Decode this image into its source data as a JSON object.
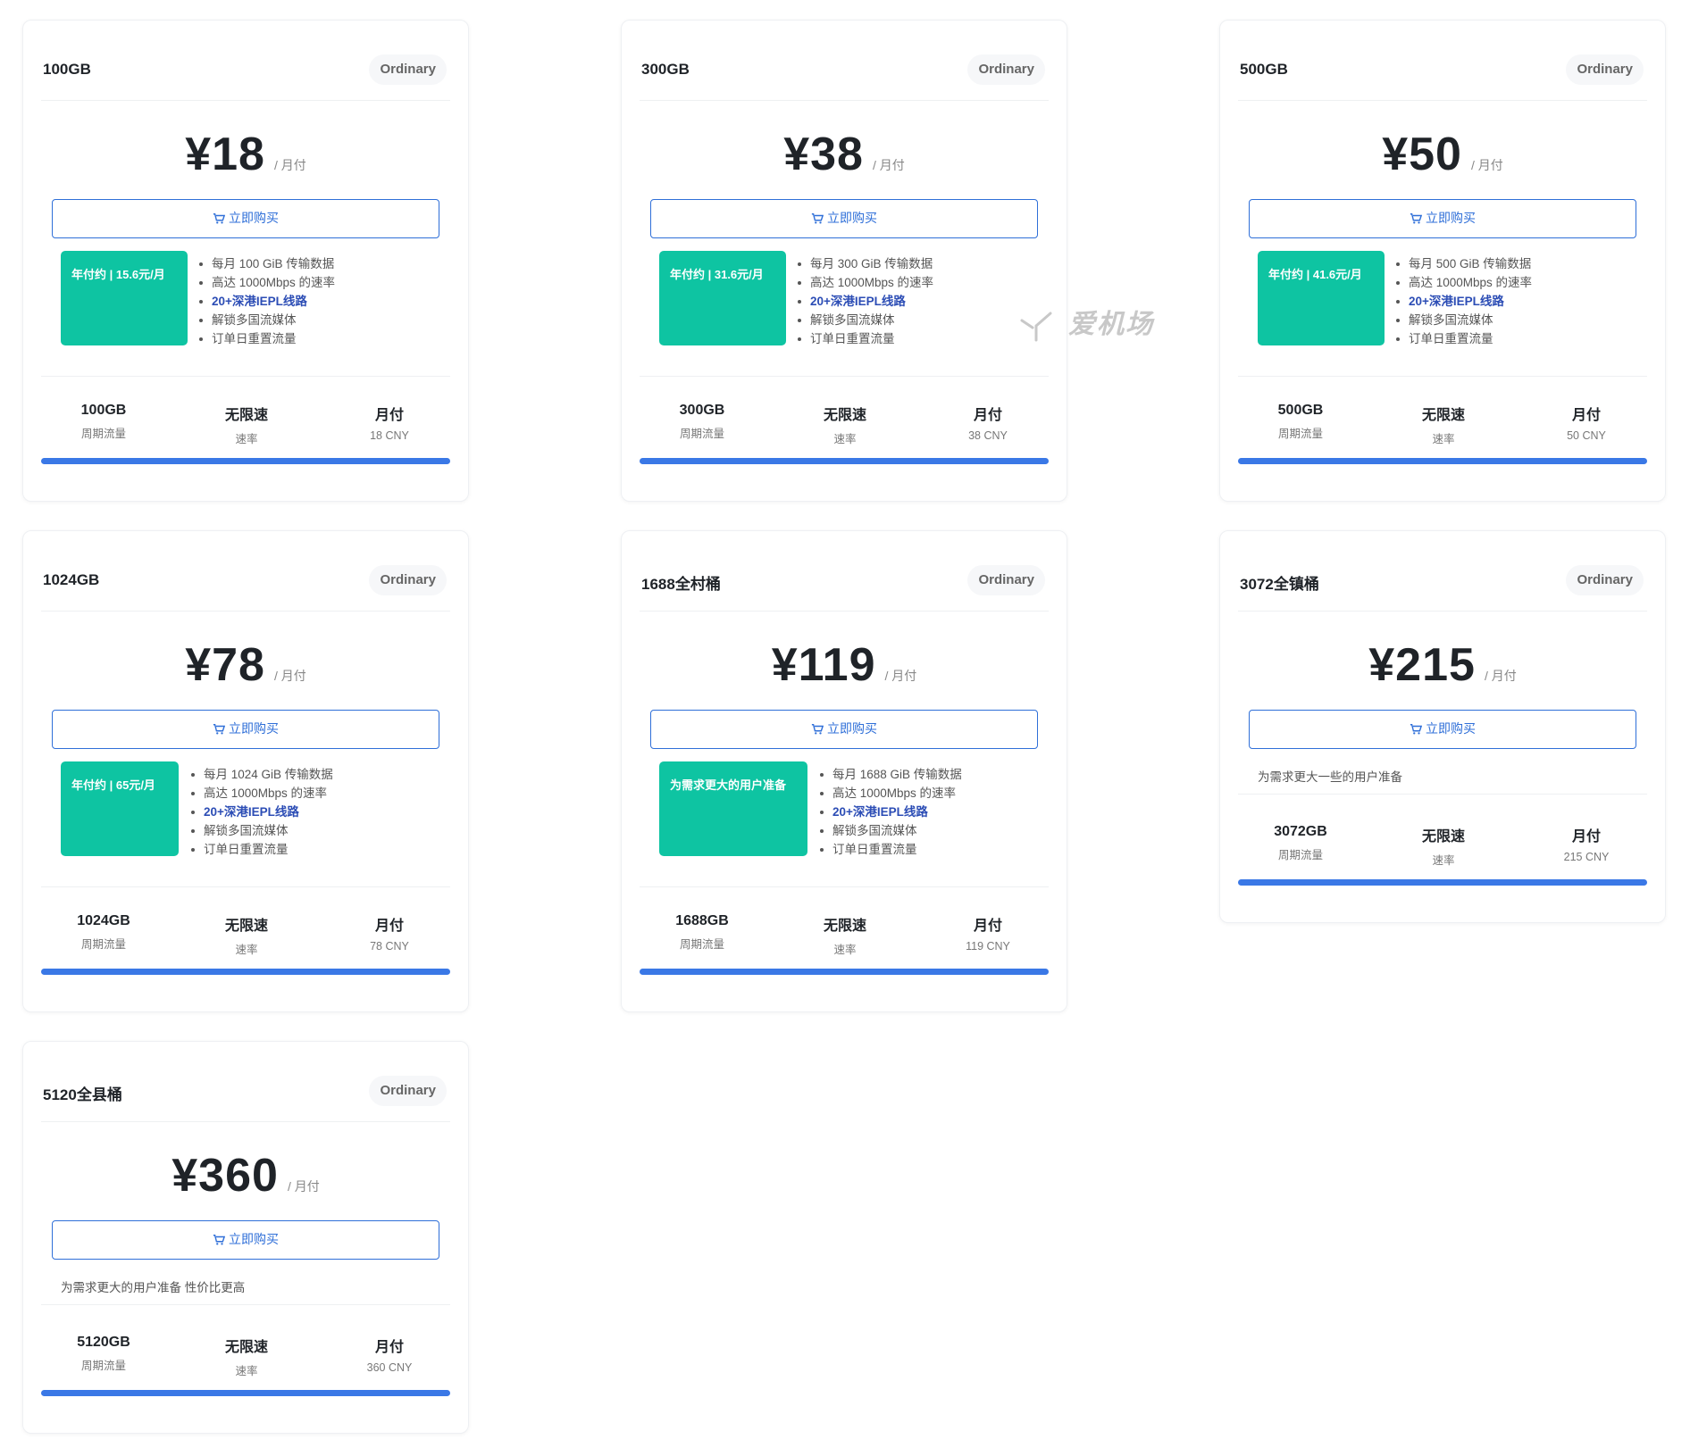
{
  "watermark": "爱机场",
  "cards": [
    {
      "title": "100GB",
      "badge": "Ordinary",
      "price": "¥18",
      "period": "/ 月付",
      "buy_label": "立即购买",
      "promo": "年付约 | 15.6元/月",
      "features": [
        "每月 100 GiB 传输数据",
        "高达 1000Mbps 的速率",
        "20+深港IEPL线路",
        "解锁多国流媒体",
        "订单日重置流量"
      ],
      "stats": [
        {
          "value": "100GB",
          "label": "周期流量"
        },
        {
          "value": "无限速",
          "label": "速率"
        },
        {
          "value": "月付",
          "label": "18 CNY"
        }
      ]
    },
    {
      "title": "300GB",
      "badge": "Ordinary",
      "price": "¥38",
      "period": "/ 月付",
      "buy_label": "立即购买",
      "promo": "年付约 | 31.6元/月",
      "features": [
        "每月 300 GiB 传输数据",
        "高达 1000Mbps 的速率",
        "20+深港IEPL线路",
        "解锁多国流媒体",
        "订单日重置流量"
      ],
      "stats": [
        {
          "value": "300GB",
          "label": "周期流量"
        },
        {
          "value": "无限速",
          "label": "速率"
        },
        {
          "value": "月付",
          "label": "38 CNY"
        }
      ]
    },
    {
      "title": "500GB",
      "badge": "Ordinary",
      "price": "¥50",
      "period": "/ 月付",
      "buy_label": "立即购买",
      "promo": "年付约 | 41.6元/月",
      "features": [
        "每月 500 GiB 传输数据",
        "高达 1000Mbps 的速率",
        "20+深港IEPL线路",
        "解锁多国流媒体",
        "订单日重置流量"
      ],
      "stats": [
        {
          "value": "500GB",
          "label": "周期流量"
        },
        {
          "value": "无限速",
          "label": "速率"
        },
        {
          "value": "月付",
          "label": "50 CNY"
        }
      ]
    },
    {
      "title": "1024GB",
      "badge": "Ordinary",
      "price": "¥78",
      "period": "/ 月付",
      "buy_label": "立即购买",
      "promo": "年付约 | 65元/月",
      "features": [
        "每月 1024 GiB 传输数据",
        "高达 1000Mbps 的速率",
        "20+深港IEPL线路",
        "解锁多国流媒体",
        "订单日重置流量"
      ],
      "stats": [
        {
          "value": "1024GB",
          "label": "周期流量"
        },
        {
          "value": "无限速",
          "label": "速率"
        },
        {
          "value": "月付",
          "label": "78 CNY"
        }
      ]
    },
    {
      "title": "1688全村桶",
      "badge": "Ordinary",
      "price": "¥119",
      "period": "/ 月付",
      "buy_label": "立即购买",
      "promo": "为需求更大的用户准备",
      "features": [
        "每月 1688 GiB 传输数据",
        "高达 1000Mbps 的速率",
        "20+深港IEPL线路",
        "解锁多国流媒体",
        "订单日重置流量"
      ],
      "stats": [
        {
          "value": "1688GB",
          "label": "周期流量"
        },
        {
          "value": "无限速",
          "label": "速率"
        },
        {
          "value": "月付",
          "label": "119 CNY"
        }
      ]
    },
    {
      "title": "3072全镇桶",
      "badge": "Ordinary",
      "price": "¥215",
      "period": "/ 月付",
      "buy_label": "立即购买",
      "desc": "为需求更大一些的用户准备",
      "stats": [
        {
          "value": "3072GB",
          "label": "周期流量"
        },
        {
          "value": "无限速",
          "label": "速率"
        },
        {
          "value": "月付",
          "label": "215 CNY"
        }
      ]
    },
    {
      "title": "5120全县桶",
      "badge": "Ordinary",
      "price": "¥360",
      "period": "/ 月付",
      "buy_label": "立即购买",
      "desc": "为需求更大的用户准备 性价比更高",
      "stats": [
        {
          "value": "5120GB",
          "label": "周期流量"
        },
        {
          "value": "无限速",
          "label": "速率"
        },
        {
          "value": "月付",
          "label": "360 CNY"
        }
      ]
    }
  ]
}
